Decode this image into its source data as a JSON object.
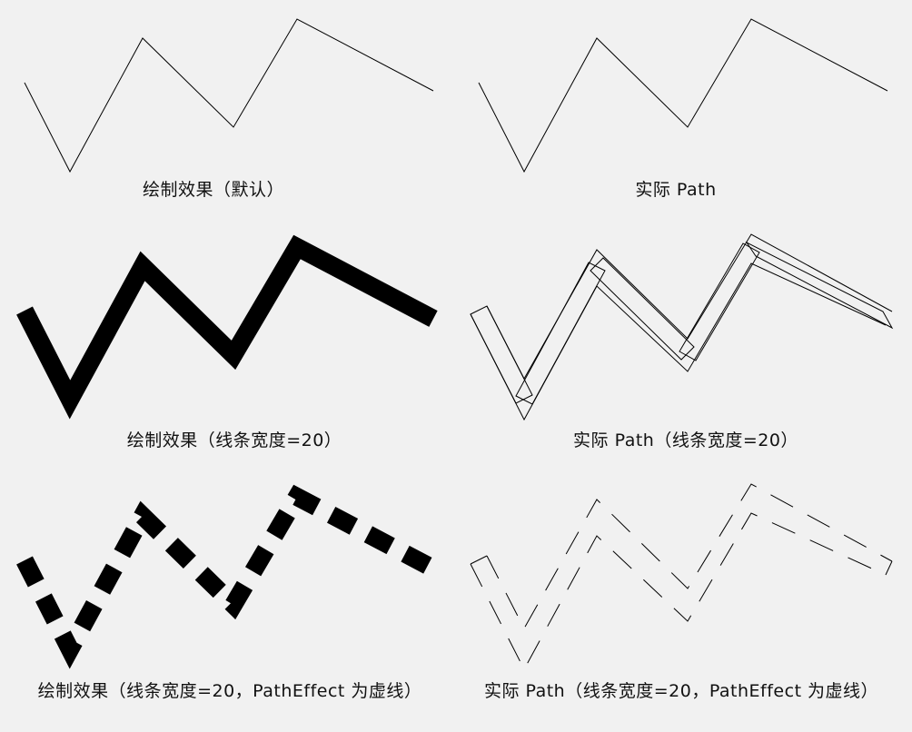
{
  "captions": {
    "row1_left": "绘制效果（默认）",
    "row1_right": "实际 Path",
    "row2_left": "绘制效果（线条宽度=20）",
    "row2_right": "实际 Path（线条宽度=20）",
    "row3_left": "绘制效果（线条宽度=20，PathEffect 为虚线）",
    "row3_right": "实际 Path（线条宽度=20，PathEffect 为虚线）"
  },
  "colors": {
    "background": "#f1f1f1",
    "stroke": "#000000"
  }
}
